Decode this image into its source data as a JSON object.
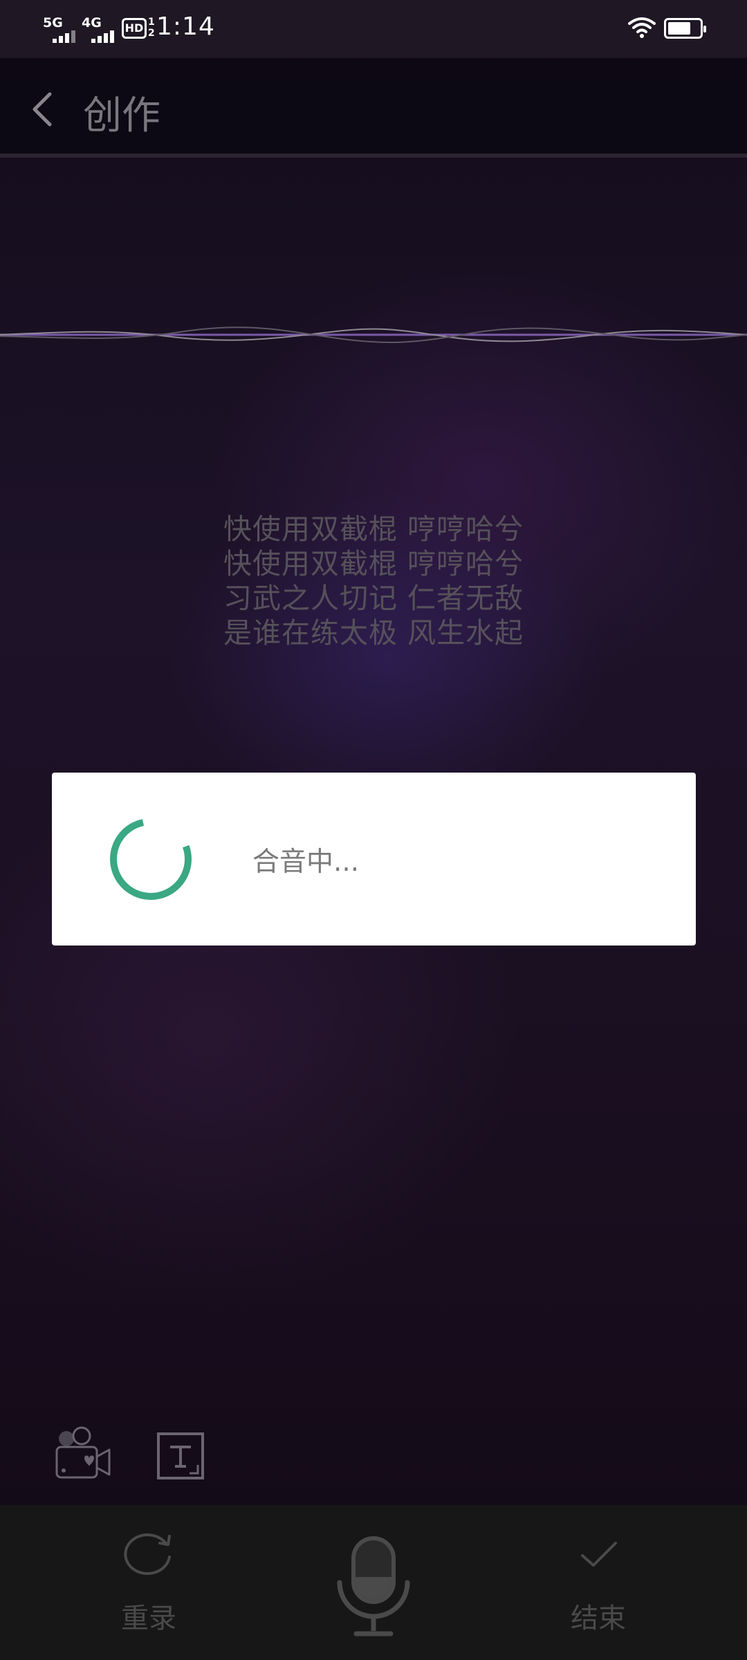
{
  "status_bar": {
    "network_1": "5G",
    "network_2": "4G",
    "hd_label": "HD",
    "hd_sub_top": "1",
    "hd_sub_bottom": "2",
    "time": "1:14",
    "battery_level": 0.72
  },
  "header": {
    "title": "创作"
  },
  "lyrics": [
    "快使用双截棍 哼哼哈兮",
    "快使用双截棍 哼哼哈兮",
    "习武之人切记 仁者无敌",
    "是谁在练太极 风生水起"
  ],
  "dialog": {
    "message": "合音中..."
  },
  "tools": {
    "video_icon": "video-camera-heart-icon",
    "text_icon": "text-frame-icon"
  },
  "bottom_bar": {
    "rerecord_label": "重录",
    "finish_label": "结束",
    "mic_icon": "microphone-icon"
  },
  "colors": {
    "spinner": "#3aa883",
    "dialog_bg": "#ffffff",
    "bottom_bar_bg": "#171717",
    "wave_line": "#7b5aa8"
  }
}
